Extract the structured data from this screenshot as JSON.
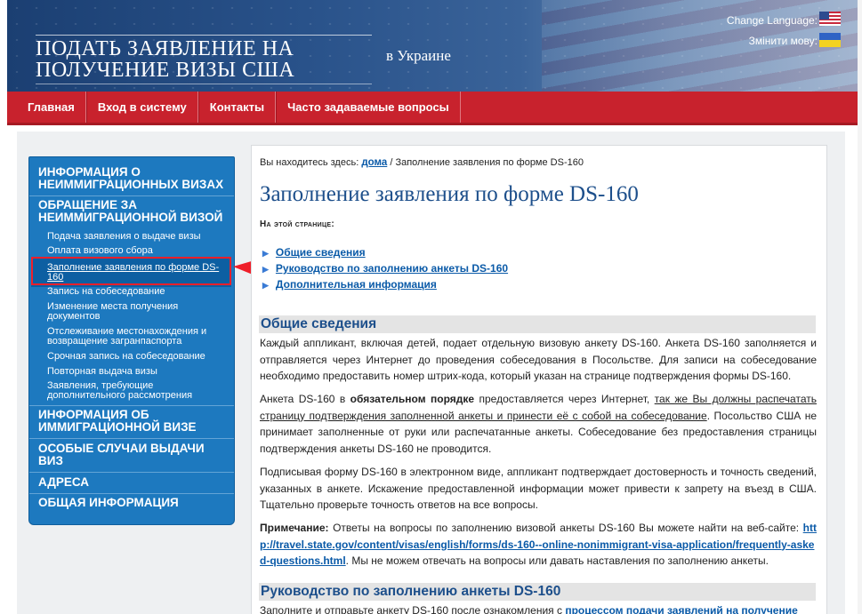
{
  "header": {
    "title_line1": "ПОДАТЬ ЗАЯВЛЕНИЕ НА",
    "title_line2": "ПОЛУЧЕНИЕ ВИЗЫ США",
    "country": "в Украине",
    "change_language": "Change Language:",
    "change_language_ua": "Змінити мову:"
  },
  "nav": {
    "items": [
      "Главная",
      "Вход в систему",
      "Контакты",
      "Часто задаваемые вопросы"
    ]
  },
  "sidebar": {
    "sec1": "ИНФОРМАЦИЯ О НЕИММИГРАЦИОННЫХ ВИЗАХ",
    "sec2": "ОБРАЩЕНИЕ ЗА НЕИММИГРАЦИОННОЙ ВИЗОЙ",
    "sub": [
      "Подача заявления о выдаче визы",
      "Оплата визового сбора",
      "Заполнение заявления по форме DS-160",
      "Запись на собеседование",
      "Изменение места получения документов",
      "Отслеживание местонахождения и возвращение загранпаспорта",
      "Срочная запись на собеседование",
      "Повторная выдача визы",
      "Заявления, требующие дополнительного рассмотрения"
    ],
    "sec3": "ИНФОРМАЦИЯ ОБ ИММИГРАЦИОННОЙ ВИЗЕ",
    "sec4": "ОСОБЫЕ СЛУЧАИ ВЫДАЧИ ВИЗ",
    "sec5": "АДРЕСА",
    "sec6": "ОБЩАЯ ИНФОРМАЦИЯ"
  },
  "content": {
    "breadcrumb_prefix": "Вы находитесь здесь:",
    "breadcrumb_home": "дома",
    "breadcrumb_current": "/ Заполнение заявления по форме DS-160",
    "title": "Заполнение заявления по форме DS-160",
    "on_this_page": "На этой странице:",
    "toc": [
      "Общие сведения",
      "Руководство по заполнению анкеты DS-160",
      "Дополнительная информация"
    ],
    "sec1_title": "Общие сведения",
    "p1": "Каждый аппликант, включая детей, подает отдельную визовую анкету DS-160. Анкета DS-160 заполняется и отправляется через Интернет до проведения собеседования в Посольстве. Для записи на собеседование необходимо предоставить номер штрих-кода, который указан на странице подтверждения формы DS-160.",
    "p2_a": "Анкета DS-160 в ",
    "p2_bold": "обязательном порядке",
    "p2_b": " предоставляется через Интернет, ",
    "p2_ul": "так же Вы должны распечатать страницу подтверждения заполненной анкеты и принести её с собой на собеседование",
    "p2_c": ". Посольство США не принимает заполненные от руки или распечатанные анкеты. Собеседование без предоставления страницы подтверждения анкеты DS-160 не проводится.",
    "p3": "Подписывая форму DS-160 в электронном виде, аппликант подтверждает достоверность и точность сведений, указанных в анкете. Искажение предоставленной информации может привести к запрету на въезд в США. Тщательно проверьте точность ответов на все вопросы.",
    "p4_label": "Примечание:",
    "p4_a": " Ответы на вопросы по заполнению визовой анкеты DS-160 Вы можете найти на веб-сайте: ",
    "p4_link": "http://travel.state.gov/content/visas/english/forms/ds-160--online-nonimmigrant-visa-application/frequently-asked-questions.html",
    "p4_b": ". Мы не можем отвечать на вопросы или давать наставления по заполнению анкеты.",
    "sec2_title": "Руководство по заполнению анкеты DS-160",
    "p5_a": "Заполните и отправьте анкету DS-160 после ознакомления с ",
    "p5_link": "процессом подачи заявлений на получение"
  },
  "colors": {
    "nav_red": "#c8222d",
    "sidebar_blue": "#1d79bf",
    "link_blue": "#0a5aa8",
    "title_blue": "#1d4f8b",
    "annotation_red": "#ef1f2a"
  }
}
